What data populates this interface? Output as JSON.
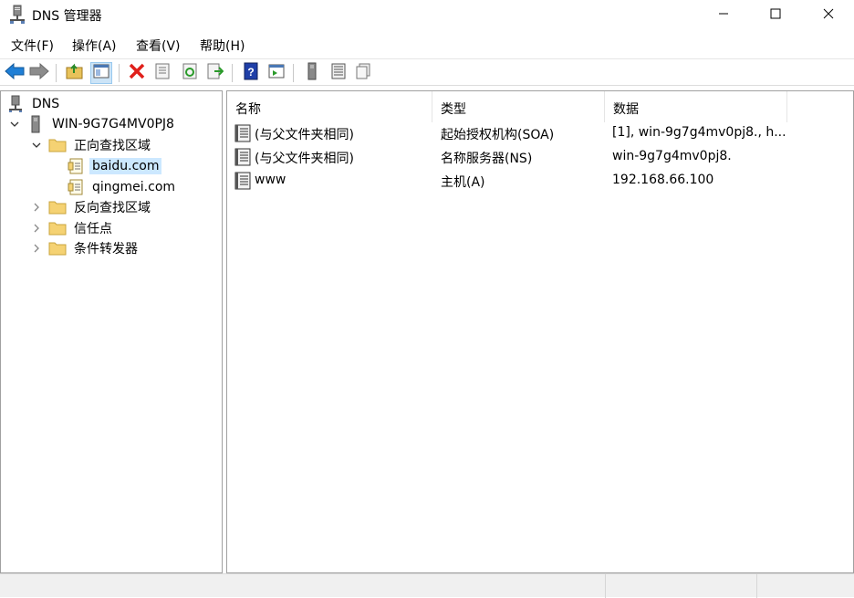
{
  "window": {
    "title": "DNS 管理器",
    "app_icon": "dns-server-icon",
    "controls": [
      "minimize-icon",
      "maximize-icon",
      "close-icon"
    ]
  },
  "menu": {
    "items": [
      {
        "label": "文件(F)"
      },
      {
        "label": "操作(A)"
      },
      {
        "label": "查看(V)"
      },
      {
        "label": "帮助(H)"
      }
    ]
  },
  "toolbar": {
    "buttons": [
      "back-arrow-icon",
      "forward-arrow-icon",
      "up-folder-icon",
      "show-hide-tree-icon",
      "delete-icon",
      "properties-icon",
      "refresh-icon",
      "export-list-icon",
      "help-icon",
      "action-pane-icon",
      "server-icon",
      "zone-list-icon",
      "record-copy-icon"
    ]
  },
  "tree": {
    "root": "DNS",
    "server": "WIN-9G7G4MV0PJ8",
    "forward_zones": "正向查找区域",
    "zones": [
      "baidu.com",
      "qingmei.com"
    ],
    "reverse_zones": "反向查找区域",
    "trust_points": "信任点",
    "conditional_forwarders": "条件转发器",
    "selected": "baidu.com"
  },
  "list": {
    "columns": [
      "名称",
      "类型",
      "数据"
    ],
    "rows": [
      {
        "name": "(与父文件夹相同)",
        "type": "起始授权机构(SOA)",
        "data": "[1], win-9g7g4mv0pj8., h..."
      },
      {
        "name": "(与父文件夹相同)",
        "type": "名称服务器(NS)",
        "data": "win-9g7g4mv0pj8."
      },
      {
        "name": "www",
        "type": "主机(A)",
        "data": "192.168.66.100"
      }
    ]
  },
  "colors": {
    "selection": "#cce8ff",
    "border": "#a0a0a0",
    "delete_red": "#e0201b",
    "nav_blue": "#1f7fd6"
  }
}
